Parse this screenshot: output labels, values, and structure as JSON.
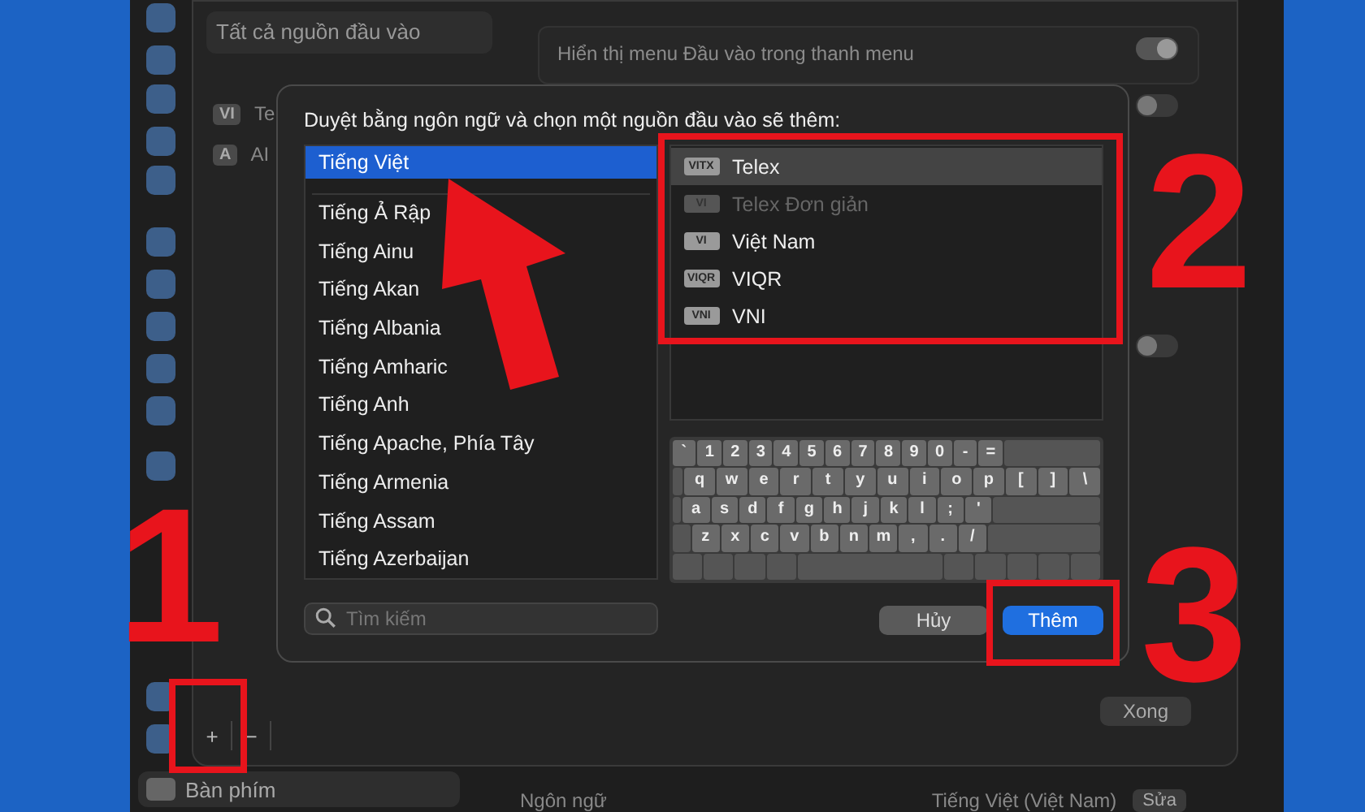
{
  "background": {
    "sources_header": "Tất cả nguồn đầu vào",
    "sources": [
      {
        "badge": "VI",
        "label": "Te"
      },
      {
        "badge": "A",
        "label": "AI"
      }
    ],
    "settings_row": "Hiển thị menu Đầu vào trong thanh menu",
    "toggles": [
      {
        "on": true
      },
      {
        "on": false
      },
      {
        "on": false
      }
    ],
    "add_label": "+",
    "remove_label": "−",
    "done_button": "Xong",
    "sidebar_item": "Bàn phím",
    "language_row": {
      "label": "Ngôn ngữ",
      "value": "Tiếng Việt (Việt Nam)",
      "button": "Sửa"
    }
  },
  "dialog": {
    "title": "Duyệt bằng ngôn ngữ và chọn một nguồn đầu vào sẽ thêm:",
    "languages": [
      {
        "label": "Tiếng Việt",
        "selected": true
      },
      {
        "label": "Tiếng Ả Rập",
        "selected": false
      },
      {
        "label": "Tiếng Ainu",
        "selected": false
      },
      {
        "label": "Tiếng Akan",
        "selected": false
      },
      {
        "label": "Tiếng Albania",
        "selected": false
      },
      {
        "label": "Tiếng Amharic",
        "selected": false
      },
      {
        "label": "Tiếng Anh",
        "selected": false
      },
      {
        "label": "Tiếng Apache, Phía Tây",
        "selected": false
      },
      {
        "label": "Tiếng Armenia",
        "selected": false
      },
      {
        "label": "Tiếng Assam",
        "selected": false
      },
      {
        "label": "Tiếng Azerbaijan",
        "selected": false
      }
    ],
    "input_sources": [
      {
        "badge": "VITX",
        "label": "Telex",
        "selected": true,
        "disabled": false
      },
      {
        "badge": "VI",
        "label": "Telex Đơn giản",
        "selected": false,
        "disabled": true
      },
      {
        "badge": "VI",
        "label": "Việt Nam",
        "selected": false,
        "disabled": false
      },
      {
        "badge": "VIQR",
        "label": "VIQR",
        "selected": false,
        "disabled": false
      },
      {
        "badge": "VNI",
        "label": "VNI",
        "selected": false,
        "disabled": false
      }
    ],
    "keyboard_rows": [
      [
        "`",
        "1",
        "2",
        "3",
        "4",
        "5",
        "6",
        "7",
        "8",
        "9",
        "0",
        "-",
        "="
      ],
      [
        "q",
        "w",
        "e",
        "r",
        "t",
        "y",
        "u",
        "i",
        "o",
        "p",
        "[",
        "]",
        "\\"
      ],
      [
        "a",
        "s",
        "d",
        "f",
        "g",
        "h",
        "j",
        "k",
        "l",
        ";",
        "'"
      ],
      [
        "z",
        "x",
        "c",
        "v",
        "b",
        "n",
        "m",
        ",",
        ".",
        "/"
      ]
    ],
    "search": {
      "placeholder": "Tìm kiếm"
    },
    "cancel_button": "Hủy",
    "add_button": "Thêm"
  },
  "annotations": [
    {
      "label": "1"
    },
    {
      "label": "2"
    },
    {
      "label": "3"
    }
  ]
}
